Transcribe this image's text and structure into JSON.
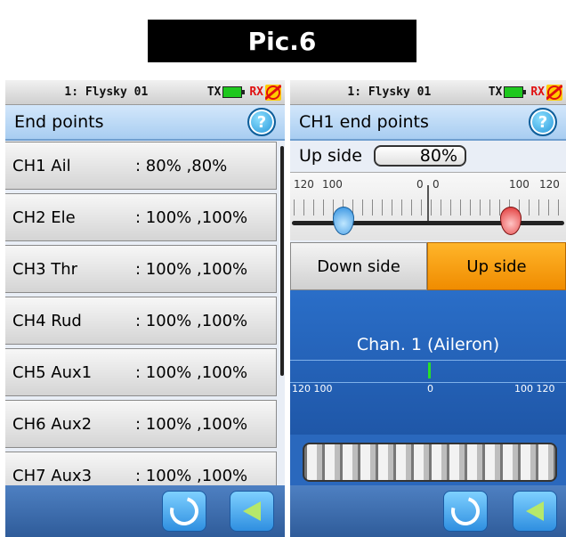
{
  "caption": "",
  "pic_label": "Pic.6",
  "left": {
    "status": {
      "model": "1: Flysky 01",
      "tx": "TX",
      "rx": "RX"
    },
    "title": "End points",
    "rows": [
      {
        "ch": "CH1 Ail",
        "val": ": 80%  ,80%"
      },
      {
        "ch": "CH2 Ele",
        "val": ": 100% ,100%"
      },
      {
        "ch": "CH3 Thr",
        "val": ": 100% ,100%"
      },
      {
        "ch": "CH4 Rud",
        "val": ": 100% ,100%"
      },
      {
        "ch": "CH5 Aux1",
        "val": ": 100% ,100%"
      },
      {
        "ch": "CH6 Aux2",
        "val": ": 100% ,100%"
      },
      {
        "ch": "CH7 Aux3",
        "val": ": 100% ,100%"
      }
    ]
  },
  "right": {
    "status": {
      "model": "1: Flysky 01",
      "tx": "TX",
      "rx": "RX"
    },
    "title": "CH1 end points",
    "up_side_label": "Up side",
    "up_side_value": "80%",
    "ruler_labels": {
      "l1": "120",
      "l2": "100",
      "l3": "0",
      "r3": "0",
      "r2": "100",
      "r1": "120"
    },
    "down_side_btn": "Down side",
    "up_side_btn": "Up side",
    "channel_name": "Chan. 1 (Aileron)",
    "chan_scale": {
      "left": "120 100",
      "mid": "0",
      "right": "100 120"
    }
  }
}
